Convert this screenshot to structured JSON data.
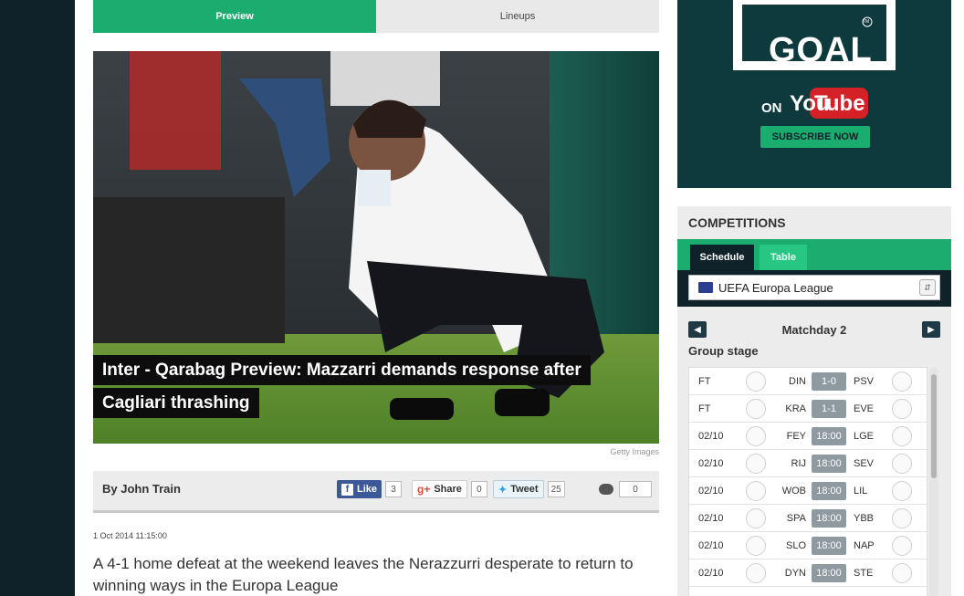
{
  "tabs": {
    "preview": "Preview",
    "lineups": "Lineups"
  },
  "article": {
    "headline": "Inter - Qarabag Preview: Mazzarri demands response after Cagliari thrashing",
    "photo_credit": "Getty Images",
    "author": "By John Train",
    "date": "1 Oct 2014 11:15:00",
    "lead": "A 4-1 home defeat at the weekend leaves the Nerazzurri desperate to return to winning ways in the Europa League"
  },
  "social": {
    "like_label": "Like",
    "like_count": "3",
    "share_label": "Share",
    "share_count": "0",
    "tweet_label": "Tweet",
    "tweet_count": "25",
    "comment_count": "0"
  },
  "ad": {
    "brand": "GOAL",
    "tm": "TM",
    "on": "ON",
    "you": "You",
    "tube": "Tube",
    "cta": "SUBSCRIBE NOW"
  },
  "competitions": {
    "title": "COMPETITIONS",
    "tab_schedule": "Schedule",
    "tab_table": "Table",
    "selected": "UEFA Europa League",
    "matchday": "Matchday 2",
    "group": "Group stage",
    "fixtures": [
      {
        "date": "FT",
        "home": "DIN",
        "score": "1-0",
        "away": "PSV"
      },
      {
        "date": "FT",
        "home": "KRA",
        "score": "1-1",
        "away": "EVE"
      },
      {
        "date": "02/10",
        "home": "FEY",
        "score": "18:00",
        "away": "LGE"
      },
      {
        "date": "02/10",
        "home": "RIJ",
        "score": "18:00",
        "away": "SEV"
      },
      {
        "date": "02/10",
        "home": "WOB",
        "score": "18:00",
        "away": "LIL"
      },
      {
        "date": "02/10",
        "home": "SPA",
        "score": "18:00",
        "away": "YBB"
      },
      {
        "date": "02/10",
        "home": "SLO",
        "score": "18:00",
        "away": "NAP"
      },
      {
        "date": "02/10",
        "home": "DYN",
        "score": "18:00",
        "away": "STE"
      }
    ]
  },
  "colors": {
    "green": "#1bac70",
    "dark": "#0f2229"
  }
}
